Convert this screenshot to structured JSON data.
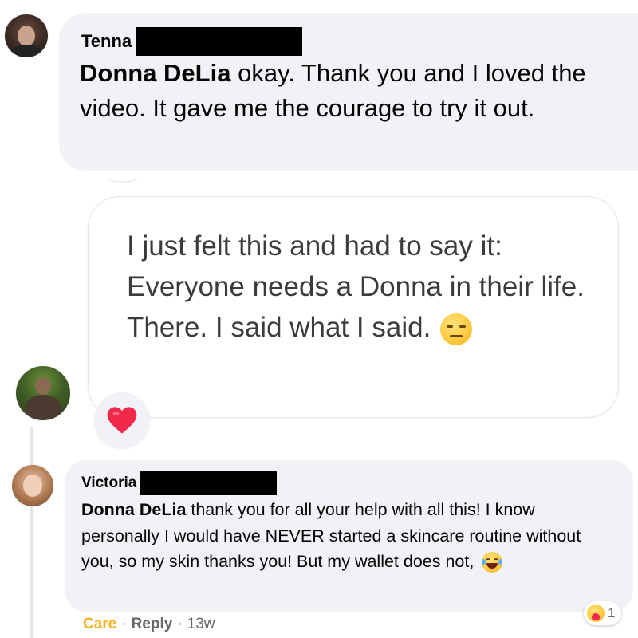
{
  "comment1": {
    "author": "Tenna",
    "mention": "Donna DeLia",
    "text": " okay. Thank you and I loved the video. It gave me the courage to try it out."
  },
  "shared_post": {
    "text": "I just felt this and had to say it: Everyone needs a Donna in their life. There. I said what I said.",
    "emoji_icon": "expressionless-face-icon",
    "reaction_icon": "heart-icon",
    "reaction_color": "#f02849"
  },
  "comment2": {
    "author": "Victoria",
    "mention": "Donna DeLia",
    "text": " thank you for all your help with all this! I know personally I would have NEVER started a skincare routine without you, so my skin thanks you! But my wallet does not,",
    "emoji_icon": "face-with-tears-of-joy-icon",
    "actions": {
      "care": "Care",
      "sep1": "·",
      "reply": "Reply",
      "sep2": "·",
      "time": "13w"
    },
    "reaction_count": "1",
    "reaction_icon": "care-face-icon"
  },
  "colors": {
    "bubble": "#f0f2f5",
    "care": "#f7b125",
    "secondary_text": "#65676b"
  }
}
